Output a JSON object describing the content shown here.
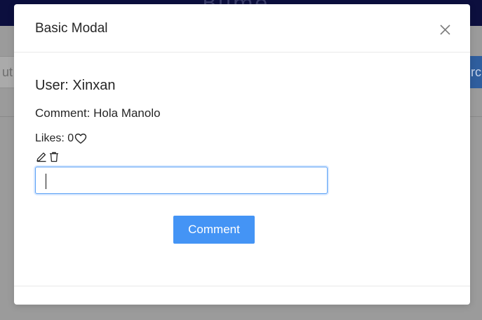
{
  "background": {
    "header_title": "Bume",
    "input_placeholder_fragment": "ut",
    "search_button_fragment": "rch"
  },
  "modal": {
    "title": "Basic Modal",
    "user_label": "User: Xinxan",
    "comment_label": "Comment: Hola Manolo",
    "likes_label": "Likes: 0",
    "input_value": "",
    "comment_button_label": "Comment"
  },
  "icons": {
    "close": "close-icon",
    "like": "heart-icon",
    "edit": "pencil-icon",
    "delete": "trash-icon"
  },
  "colors": {
    "header_bg": "#0c0f3e",
    "primary_button": "#4494f5",
    "input_focus_border": "#5aa0f5",
    "overlay": "#9a9a9a"
  }
}
